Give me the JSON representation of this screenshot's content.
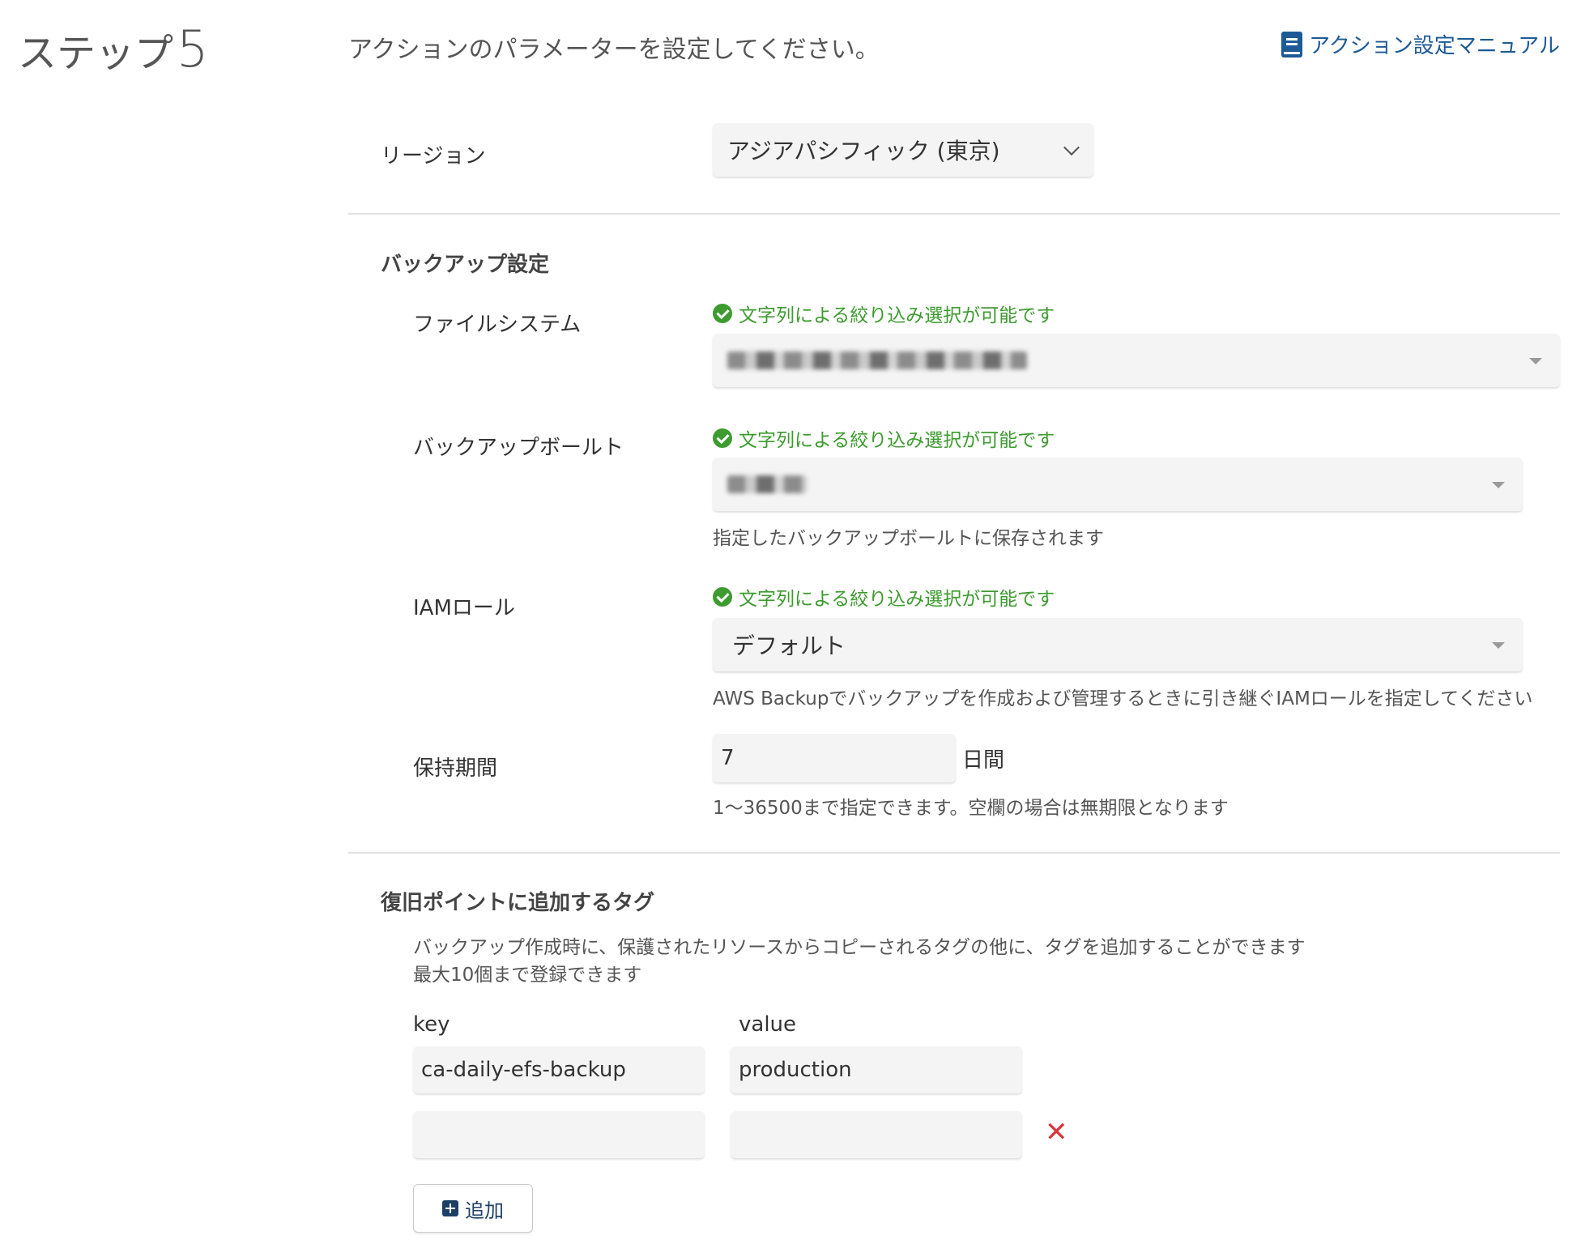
{
  "step": {
    "label": "ステップ",
    "number": "5"
  },
  "subtitle": "アクションのパラメーターを設定してください。",
  "manual_link": {
    "label": "アクション設定マニュアル",
    "icon": "book-icon"
  },
  "region": {
    "label": "リージョン",
    "value": "アジアパシフィック (東京)"
  },
  "backup": {
    "title": "バックアップ設定",
    "filter_hint": "文字列による絞り込み選択が可能です",
    "filesystem": {
      "label": "ファイルシステム"
    },
    "vault": {
      "label": "バックアップボールト",
      "help": "指定したバックアップボールトに保存されます"
    },
    "iam": {
      "label": "IAMロール",
      "value": "デフォルト",
      "help": "AWS Backupでバックアップを作成および管理するときに引き継ぐIAMロールを指定してください"
    },
    "retention": {
      "label": "保持期間",
      "value": "7",
      "unit": "日間",
      "help": "1〜36500まで指定できます。空欄の場合は無期限となります"
    }
  },
  "tags": {
    "title": "復旧ポイントに追加するタグ",
    "description_line1": "バックアップ作成時に、保護されたリソースからコピーされるタグの他に、タグを追加することができます",
    "description_line2": "最大10個まで登録できます",
    "key_header": "key",
    "value_header": "value",
    "rows": [
      {
        "key": "ca-daily-efs-backup",
        "value": "production"
      },
      {
        "key": "",
        "value": ""
      }
    ],
    "remove_symbol": "✕",
    "add_label": "追加"
  },
  "colors": {
    "accent": "#1d5a96",
    "success": "#3d9b2f",
    "danger": "#d9363e"
  }
}
